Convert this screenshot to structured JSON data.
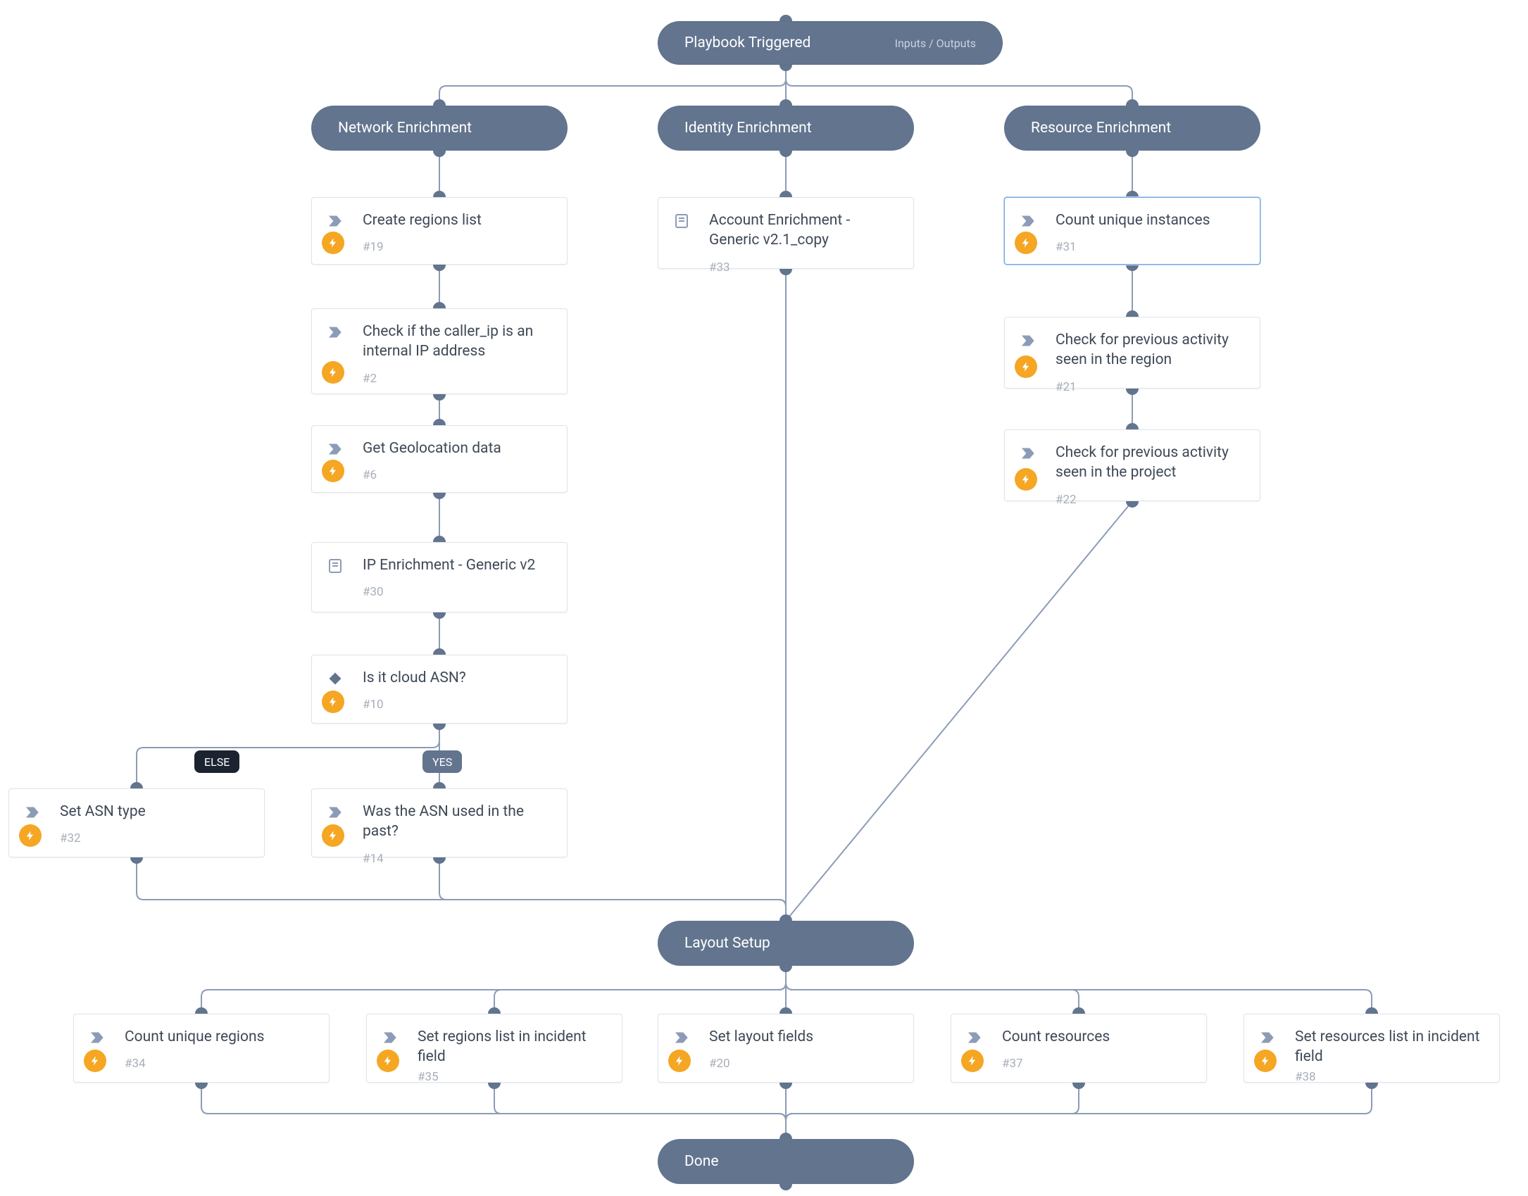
{
  "colors": {
    "node": "#62748E",
    "edge": "#8C9CB6",
    "accent": "#F5A623",
    "card_border": "#DFE3EA",
    "selected": "#6FA7E6"
  },
  "root": {
    "title": "Playbook Triggered",
    "aux": "Inputs / Outputs"
  },
  "sections": {
    "network": "Network Enrichment",
    "identity": "Identity Enrichment",
    "resource": "Resource Enrichment",
    "layout": "Layout Setup",
    "done": "Done"
  },
  "branch_labels": {
    "else": "ELSE",
    "yes": "YES"
  },
  "tasks": {
    "n19": {
      "title": "Create regions list",
      "id": "#19",
      "icon": "chevron",
      "bolt": true
    },
    "n2": {
      "title": "Check if the caller_ip is an internal IP address",
      "id": "#2",
      "icon": "chevron",
      "bolt": true
    },
    "n6": {
      "title": "Get Geolocation data",
      "id": "#6",
      "icon": "chevron",
      "bolt": true
    },
    "n30": {
      "title": "IP Enrichment - Generic v2",
      "id": "#30",
      "icon": "book",
      "bolt": false
    },
    "n10": {
      "title": "Is it cloud ASN?",
      "id": "#10",
      "icon": "diamond",
      "bolt": true
    },
    "n32": {
      "title": "Set ASN type",
      "id": "#32",
      "icon": "chevron",
      "bolt": true
    },
    "n14": {
      "title": "Was the ASN used in the past?",
      "id": "#14",
      "icon": "chevron",
      "bolt": true
    },
    "n33": {
      "title": "Account Enrichment - Generic v2.1_copy",
      "id": "#33",
      "icon": "book",
      "bolt": false
    },
    "n31": {
      "title": "Count unique instances",
      "id": "#31",
      "icon": "chevron",
      "bolt": true,
      "selected": true
    },
    "n21": {
      "title": "Check for previous activity seen in the region",
      "id": "#21",
      "icon": "chevron",
      "bolt": true
    },
    "n22": {
      "title": "Check for previous activity seen in the project",
      "id": "#22",
      "icon": "chevron",
      "bolt": true
    },
    "n34": {
      "title": "Count unique regions",
      "id": "#34",
      "icon": "chevron",
      "bolt": true
    },
    "n35": {
      "title": "Set regions list in incident field",
      "id": "#35",
      "icon": "chevron",
      "bolt": true
    },
    "n20": {
      "title": "Set layout fields",
      "id": "#20",
      "icon": "chevron",
      "bolt": true
    },
    "n37": {
      "title": "Count resources",
      "id": "#37",
      "icon": "chevron",
      "bolt": true
    },
    "n38": {
      "title": "Set resources list in incident field",
      "id": "#38",
      "icon": "chevron",
      "bolt": true
    }
  }
}
